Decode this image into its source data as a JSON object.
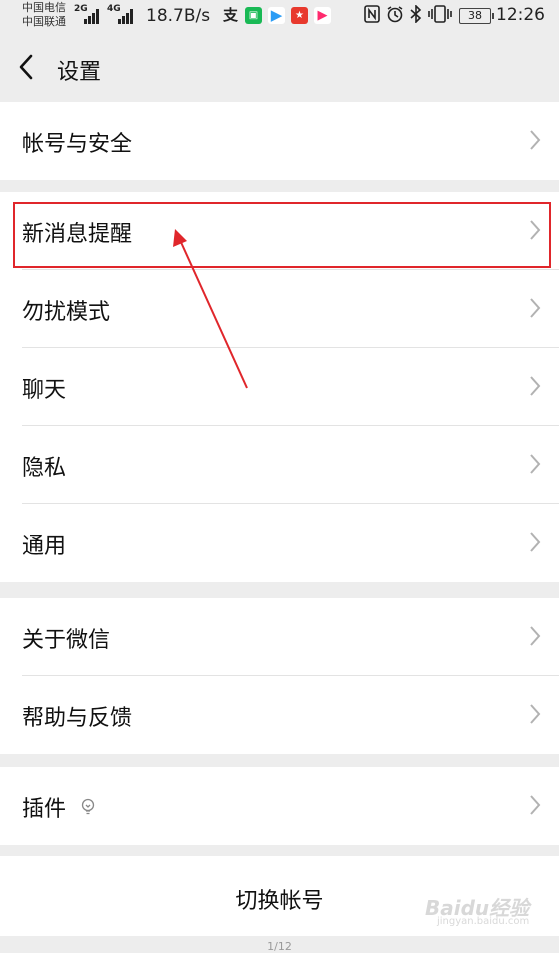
{
  "status_bar": {
    "carrier_1": "中国电信",
    "carrier_2": "中国联通",
    "signal_1": "2G",
    "signal_2": "4G",
    "speed": "18.7B/s",
    "battery": "38",
    "time": "12:26",
    "app_icons": [
      "alipay-icon",
      "iqiyi-icon",
      "tencent-video-icon",
      "app-icon",
      "youku-icon"
    ],
    "system_icons": [
      "nfc-icon",
      "alarm-icon",
      "bluetooth-icon",
      "vibrate-icon"
    ]
  },
  "nav": {
    "title": "设置"
  },
  "groups": [
    {
      "items": [
        {
          "label": "帐号与安全"
        }
      ]
    },
    {
      "items": [
        {
          "label": "新消息提醒"
        },
        {
          "label": "勿扰模式"
        },
        {
          "label": "聊天"
        },
        {
          "label": "隐私"
        },
        {
          "label": "通用"
        }
      ]
    },
    {
      "items": [
        {
          "label": "关于微信"
        },
        {
          "label": "帮助与反馈"
        }
      ]
    },
    {
      "items": [
        {
          "label": "插件"
        }
      ]
    }
  ],
  "switch_account": "切换帐号",
  "pager": "1/12",
  "watermark": {
    "text": "Baidu经验",
    "sub": "jingyan.baidu.com"
  },
  "colors": {
    "highlight": "#e0262b",
    "background": "#ededed"
  }
}
